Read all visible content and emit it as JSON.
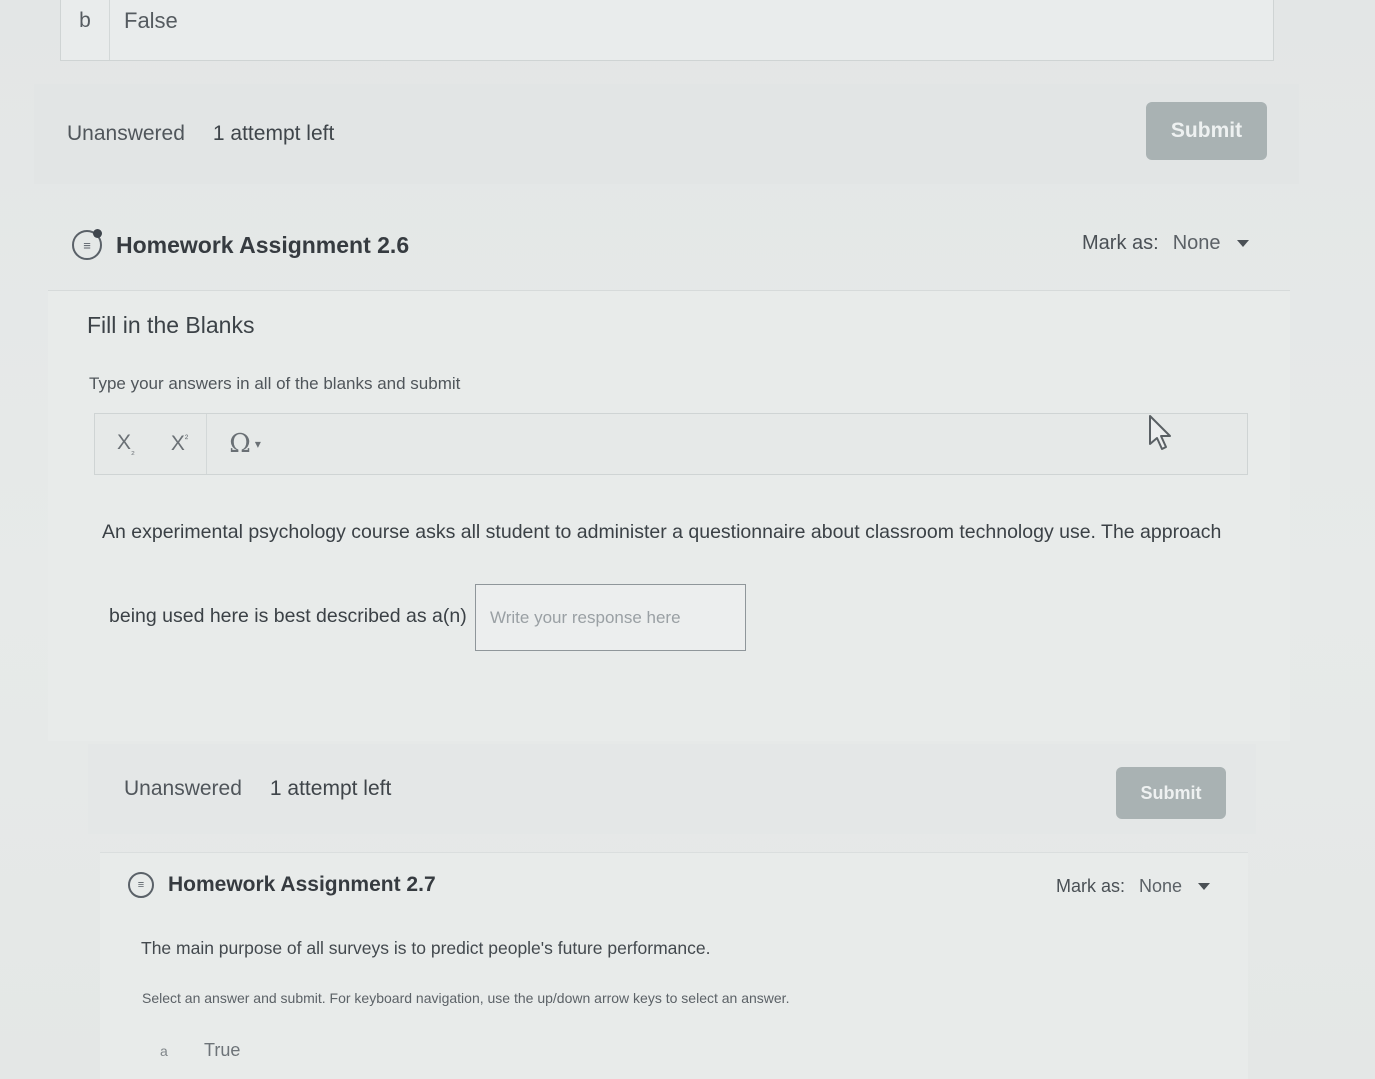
{
  "previous_question": {
    "option_b": {
      "letter": "b",
      "text": "False"
    },
    "status": "Unanswered",
    "attempts": "1 attempt left",
    "submit_label": "Submit"
  },
  "question_26": {
    "title": "Homework Assignment 2.6",
    "mark_as_label": "Mark as:",
    "mark_as_value": "None",
    "type": "Fill in the Blanks",
    "instruction": "Type your answers in all of the blanks and submit",
    "toolbar": {
      "subscript": "X",
      "superscript": "X",
      "special_chars": "Ω"
    },
    "text_line_1": "An experimental psychology course asks all student to administer a questionnaire about classroom technology use. The approach",
    "text_line_2": "being used here is best described as a(n)",
    "blank_placeholder": "Write your response here",
    "blank_value": "",
    "status": "Unanswered",
    "attempts": "1 attempt left",
    "submit_label": "Submit"
  },
  "question_27": {
    "title": "Homework Assignment 2.7",
    "mark_as_label": "Mark as:",
    "mark_as_value": "None",
    "text": "The main purpose of all surveys is to predict people's future performance.",
    "instruction": "Select an answer and submit. For keyboard navigation, use the up/down arrow keys to select an answer.",
    "option_a": {
      "letter": "a",
      "text": "True"
    }
  }
}
